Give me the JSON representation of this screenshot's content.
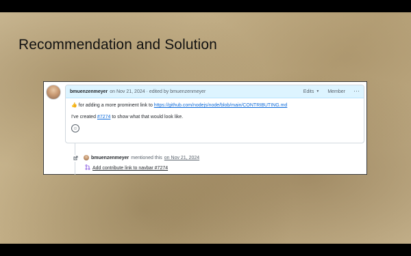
{
  "slide": {
    "title": "Recommendation and Solution"
  },
  "comment": {
    "author": "bmuenzenmeyer",
    "meta": "on Nov 21, 2024 · edited by bmuenzenmeyer",
    "edits_label": "Edits",
    "role_badge": "Member",
    "more_label": "···",
    "line1_emoji": "👍",
    "line1_text": "for adding a more prominent link to",
    "line1_link": "https://github.com/nodejs/node/blob/main/CONTRIBUTING.md",
    "line2_prefix": "I've created",
    "line2_link": "#7274",
    "line2_suffix": "to show what that would look like."
  },
  "event": {
    "author": "bmuenzenmeyer",
    "action": "mentioned this",
    "date": "on Nov 21, 2024",
    "pr_title": "Add contribute link to navbar #7274"
  },
  "icons": {
    "avatar": "user-avatar",
    "emoji_picker": "smiley-icon",
    "cross_reference": "external-link-icon",
    "pull_request": "git-pull-request-icon",
    "more": "kebab-horizontal-icon",
    "caret": "triangle-down-icon"
  },
  "colors": {
    "header_bg": "#ddf4ff",
    "link": "#0969da",
    "pr_icon": "#8250df"
  }
}
